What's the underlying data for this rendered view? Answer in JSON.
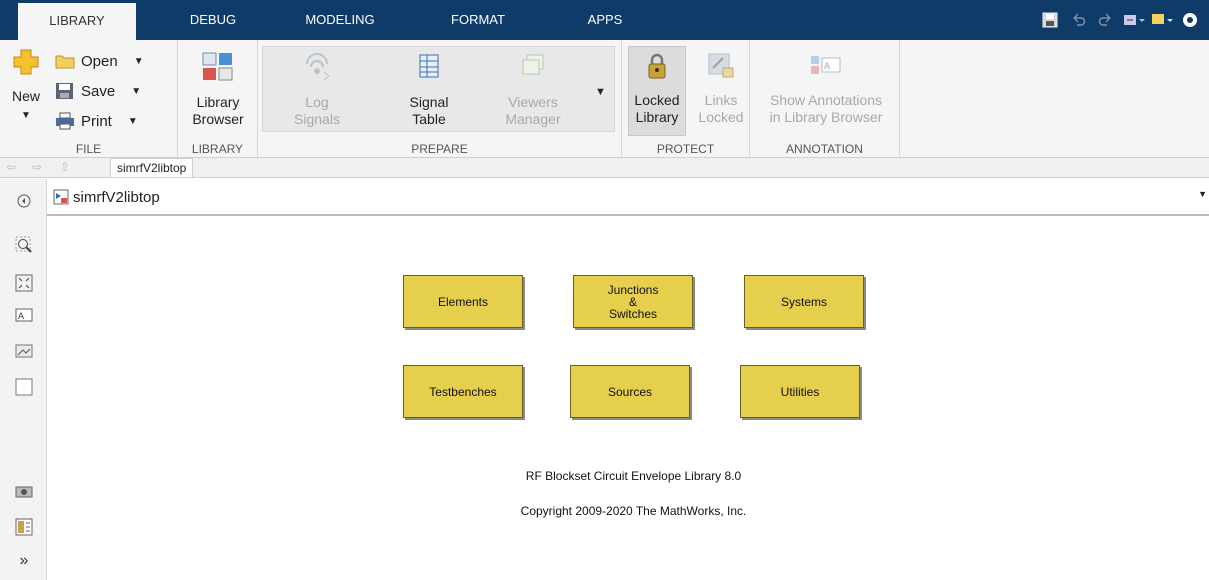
{
  "tabs": [
    {
      "label": "LIBRARY",
      "active": true
    },
    {
      "label": "DEBUG",
      "active": false
    },
    {
      "label": "MODELING",
      "active": false
    },
    {
      "label": "FORMAT",
      "active": false
    },
    {
      "label": "APPS",
      "active": false
    }
  ],
  "ribbon": {
    "file": {
      "group_label": "FILE",
      "new_label": "New",
      "open_label": "Open",
      "save_label": "Save",
      "print_label": "Print"
    },
    "library": {
      "group_label": "LIBRARY",
      "browser_line1": "Library",
      "browser_line2": "Browser"
    },
    "prepare": {
      "group_label": "PREPARE",
      "log_line1": "Log",
      "log_line2": "Signals",
      "signal_line1": "Signal",
      "signal_line2": "Table",
      "viewers_line1": "Viewers",
      "viewers_line2": "Manager"
    },
    "protect": {
      "group_label": "PROTECT",
      "locked_line1": "Locked",
      "locked_line2": "Library",
      "links_line1": "Links",
      "links_line2": "Locked"
    },
    "annotation": {
      "group_label": "ANNOTATION",
      "show_line1": "Show Annotations",
      "show_line2": "in Library Browser"
    }
  },
  "breadcrumb": {
    "label": "simrfV2libtop"
  },
  "model": {
    "name": "simrfV2libtop"
  },
  "blocks": [
    {
      "label": "Elements"
    },
    {
      "label": "Junctions\n&\nSwitches"
    },
    {
      "label": "Systems"
    },
    {
      "label": "Testbenches"
    },
    {
      "label": "Sources"
    },
    {
      "label": "Utilities"
    }
  ],
  "notes": {
    "library_title": "RF Blockset Circuit Envelope Library 8.0",
    "copyright": "Copyright 2009-2020 The MathWorks, Inc."
  },
  "colors": {
    "tabbar": "#0e3b68",
    "block_fill": "#e5cf4c",
    "ribbon_bg": "#f5f5f5"
  }
}
